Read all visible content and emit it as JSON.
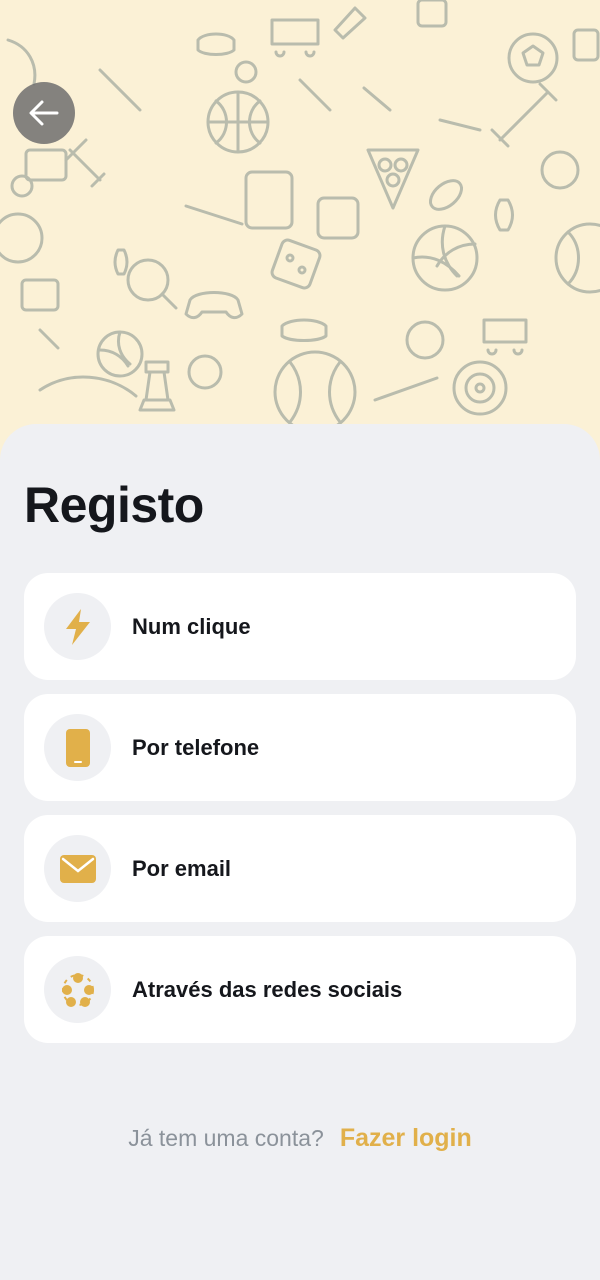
{
  "header": {
    "back_icon": "arrow-left-icon",
    "background": "sports-doodle-pattern"
  },
  "page": {
    "title": "Registo"
  },
  "options": [
    {
      "label": "Num clique",
      "icon": "lightning-icon"
    },
    {
      "label": "Por telefone",
      "icon": "phone-icon"
    },
    {
      "label": "Por email",
      "icon": "envelope-icon"
    },
    {
      "label": "Através das redes sociais",
      "icon": "social-network-icon"
    }
  ],
  "footer": {
    "question": "Já tem uma conta?",
    "login_link": "Fazer login"
  },
  "colors": {
    "accent": "#e1b04a",
    "background": "#eff0f3",
    "hero_background": "#fbf1d6",
    "text": "#15171c",
    "muted_text": "#8b929a"
  }
}
